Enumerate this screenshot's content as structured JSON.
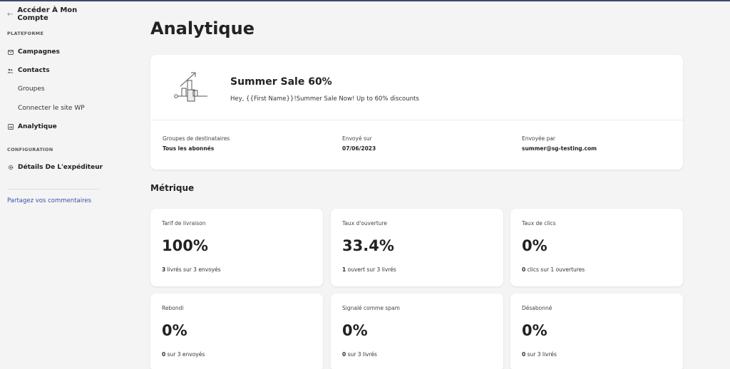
{
  "sidebar": {
    "back_label": "Accéder À Mon Compte",
    "section_platform": "PLATEFORME",
    "items": {
      "campaigns": "Campagnes",
      "contacts": "Contacts",
      "groups": "Groupes",
      "connect_wp": "Connecter le site WP",
      "analytics": "Analytique"
    },
    "section_config": "CONFIGURATION",
    "sender_details": "Détails De L'expéditeur",
    "feedback": "Partagez vos commentaires"
  },
  "main": {
    "title": "Analytique",
    "campaign": {
      "name": "Summer Sale 60%",
      "preview": "Hey, {{First Name}}!Summer Sale Now! Up to 60% discounts",
      "recipients_label": "Groupes de destinataires",
      "recipients_value": "Tous les abonnés",
      "sent_on_label": "Envoyé sur",
      "sent_on_value": "07/06/2023",
      "sent_by_label": "Envoyée par",
      "sent_by_value": "summer@sg-testing.com"
    },
    "metrics_title": "Métrique",
    "metrics": [
      {
        "label": "Tarif de livraison",
        "value": "100%",
        "count": "3",
        "sub": " livrés sur 3 envoyés"
      },
      {
        "label": "Taux d'ouverture",
        "value": "33.4%",
        "count": "1",
        "sub": " ouvert sur 3 livrés"
      },
      {
        "label": "Taux de clics",
        "value": "0%",
        "count": "0",
        "sub": " clics sur 1 ouvertures"
      },
      {
        "label": "Rebondi",
        "value": "0%",
        "count": "0",
        "sub": " sur 3 envoyés"
      },
      {
        "label": "Signalé comme spam",
        "value": "0%",
        "count": "0",
        "sub": " sur 3 livrés"
      },
      {
        "label": "Désabonné",
        "value": "0%",
        "count": "0",
        "sub": " sur 3 livrés"
      }
    ]
  },
  "icons": {
    "back": "arrow-left-icon",
    "campaigns": "envelope-icon",
    "contacts": "users-icon",
    "analytics": "chart-icon",
    "sender": "gear-icon",
    "campaign_illustration": "growth-chart-illustration"
  },
  "colors": {
    "accent_link": "#3a4fa8",
    "background": "#f4f4f5",
    "card": "#ffffff"
  }
}
